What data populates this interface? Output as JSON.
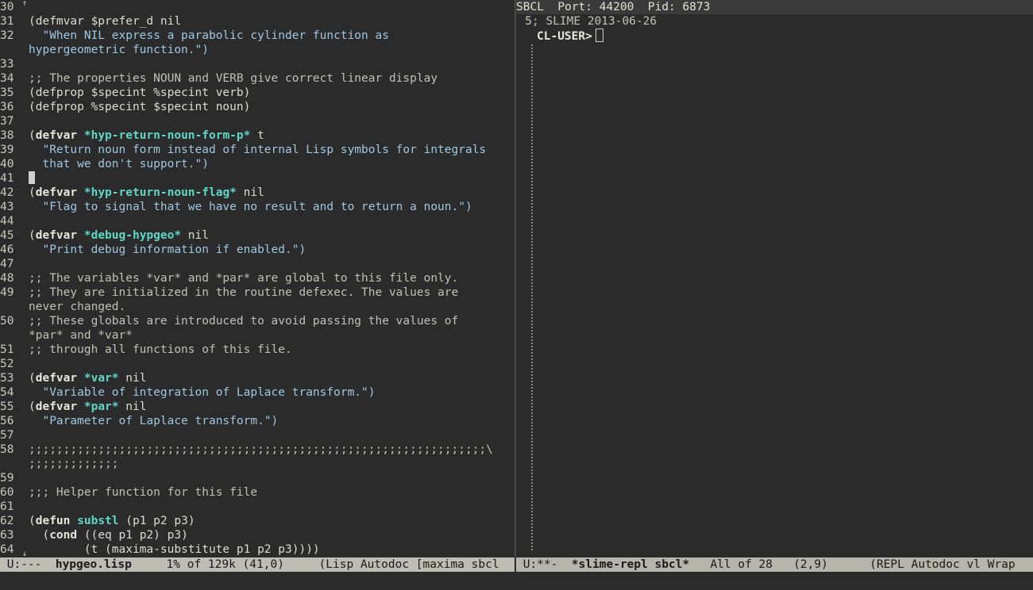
{
  "left": {
    "lines": [
      {
        "n": "30",
        "segs": []
      },
      {
        "n": "31",
        "segs": [
          {
            "t": "(defmvar $prefer_d nil"
          }
        ]
      },
      {
        "n": "32",
        "segs": [
          {
            "t": "  \"When NIL express a parabolic cylinder function as",
            "c": "str"
          }
        ]
      },
      {
        "n": "",
        "segs": [
          {
            "t": "hypergeometric function.\")",
            "c": "str"
          }
        ]
      },
      {
        "n": "33",
        "segs": []
      },
      {
        "n": "34",
        "segs": [
          {
            "t": ";; The properties NOUN and VERB give correct linear display",
            "c": "cmt"
          }
        ]
      },
      {
        "n": "35",
        "segs": [
          {
            "t": "(defprop $specint %specint verb)"
          }
        ]
      },
      {
        "n": "36",
        "segs": [
          {
            "t": "(defprop %specint $specint noun)"
          }
        ]
      },
      {
        "n": "37",
        "segs": []
      },
      {
        "n": "38",
        "segs": [
          {
            "t": "("
          },
          {
            "t": "defvar",
            "c": "kw"
          },
          {
            "t": " "
          },
          {
            "t": "*hyp-return-noun-form-p*",
            "c": "var"
          },
          {
            "t": " t"
          }
        ]
      },
      {
        "n": "39",
        "segs": [
          {
            "t": "  \"Return noun form instead of internal Lisp symbols for integrals",
            "c": "str"
          }
        ]
      },
      {
        "n": "40",
        "segs": [
          {
            "t": "  that we don't support.\")",
            "c": "str"
          }
        ]
      },
      {
        "n": "41",
        "segs": [],
        "cursor": true
      },
      {
        "n": "42",
        "segs": [
          {
            "t": "("
          },
          {
            "t": "defvar",
            "c": "kw"
          },
          {
            "t": " "
          },
          {
            "t": "*hyp-return-noun-flag*",
            "c": "var"
          },
          {
            "t": " nil"
          }
        ]
      },
      {
        "n": "43",
        "segs": [
          {
            "t": "  \"Flag to signal that we have no result and to return a noun.\")",
            "c": "str"
          }
        ]
      },
      {
        "n": "44",
        "segs": []
      },
      {
        "n": "45",
        "segs": [
          {
            "t": "("
          },
          {
            "t": "defvar",
            "c": "kw"
          },
          {
            "t": " "
          },
          {
            "t": "*debug-hypgeo*",
            "c": "var"
          },
          {
            "t": " nil"
          }
        ]
      },
      {
        "n": "46",
        "segs": [
          {
            "t": "  \"Print debug information if enabled.\")",
            "c": "str"
          }
        ]
      },
      {
        "n": "47",
        "segs": []
      },
      {
        "n": "48",
        "segs": [
          {
            "t": ";; The variables *var* and *par* are global to this file only.",
            "c": "cmt"
          }
        ]
      },
      {
        "n": "49",
        "segs": [
          {
            "t": ";; They are initialized in the routine defexec. The values are",
            "c": "cmt"
          }
        ]
      },
      {
        "n": "",
        "segs": [
          {
            "t": "never changed.",
            "c": "cmt"
          }
        ]
      },
      {
        "n": "50",
        "segs": [
          {
            "t": ";; These globals are introduced to avoid passing the values of",
            "c": "cmt"
          }
        ]
      },
      {
        "n": "",
        "segs": [
          {
            "t": "*par* and *var*",
            "c": "cmt"
          }
        ]
      },
      {
        "n": "51",
        "segs": [
          {
            "t": ";; through all functions of this file.",
            "c": "cmt"
          }
        ]
      },
      {
        "n": "52",
        "segs": []
      },
      {
        "n": "53",
        "segs": [
          {
            "t": "("
          },
          {
            "t": "defvar",
            "c": "kw"
          },
          {
            "t": " "
          },
          {
            "t": "*var*",
            "c": "var"
          },
          {
            "t": " nil"
          }
        ]
      },
      {
        "n": "54",
        "segs": [
          {
            "t": "  \"Variable of integration of Laplace transform.\")",
            "c": "str"
          }
        ]
      },
      {
        "n": "55",
        "segs": [
          {
            "t": "("
          },
          {
            "t": "defvar",
            "c": "kw"
          },
          {
            "t": " "
          },
          {
            "t": "*par*",
            "c": "var"
          },
          {
            "t": " nil"
          }
        ]
      },
      {
        "n": "56",
        "segs": [
          {
            "t": "  \"Parameter of Laplace transform.\")",
            "c": "str"
          }
        ]
      },
      {
        "n": "57",
        "segs": []
      },
      {
        "n": "58",
        "segs": [
          {
            "t": ";;;;;;;;;;;;;;;;;;;;;;;;;;;;;;;;;;;;;;;;;;;;;;;;;;;;;;;;;;;;;;;;;;\\",
            "c": "cmt"
          }
        ]
      },
      {
        "n": "",
        "segs": [
          {
            "t": ";;;;;;;;;;;;;",
            "c": "cmt"
          }
        ]
      },
      {
        "n": "59",
        "segs": []
      },
      {
        "n": "60",
        "segs": [
          {
            "t": ";;; Helper function for this file",
            "c": "cmt"
          }
        ]
      },
      {
        "n": "61",
        "segs": []
      },
      {
        "n": "62",
        "segs": [
          {
            "t": "("
          },
          {
            "t": "defun",
            "c": "kw"
          },
          {
            "t": " "
          },
          {
            "t": "substl",
            "c": "fn"
          },
          {
            "t": " (p1 p2 p3)"
          }
        ]
      },
      {
        "n": "63",
        "segs": [
          {
            "t": "  ("
          },
          {
            "t": "cond",
            "c": "kw"
          },
          {
            "t": " ((eq p1 p2) p3)"
          }
        ]
      },
      {
        "n": "64",
        "segs": [
          {
            "t": "        (t (maxima-substitute p1 p2 p3))))"
          }
        ]
      }
    ]
  },
  "right": {
    "header": "SBCL  Port: 44200  Pid: 6873",
    "line_num": "5",
    "banner": "; SLIME 2013-06-26",
    "prompt": "CL-USER>"
  },
  "modeline_left": {
    "status": " U:---  ",
    "buffer": "hypgeo.lisp",
    "position": "     1% of 129k (41,0)     ",
    "modes": "(Lisp Autodoc [maxima sbcl"
  },
  "modeline_right": {
    "status": " U:**-  ",
    "buffer": "*slime-repl sbcl*",
    "position": "   All of 28   (2,9)      ",
    "modes": "(REPL Autodoc vl Wrap"
  }
}
